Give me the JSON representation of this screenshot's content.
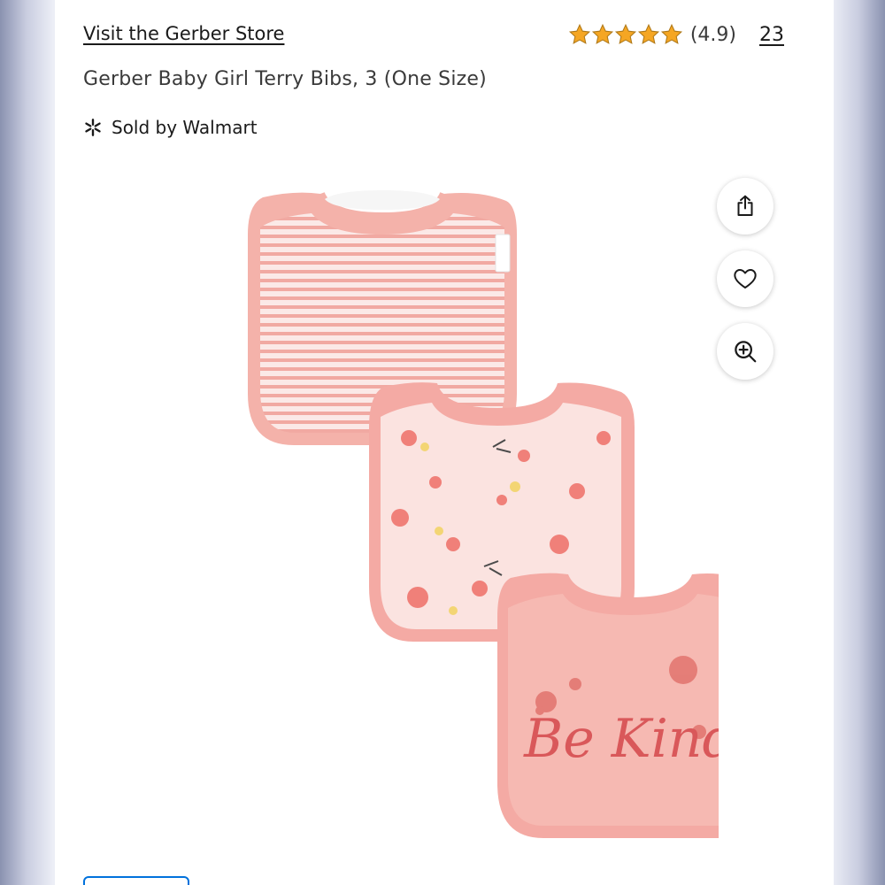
{
  "store": {
    "link_label": "Visit the Gerber Store"
  },
  "rating": {
    "stars": 5,
    "value": "(4.9)",
    "review_count": "23",
    "star_color": "#f5a623"
  },
  "product": {
    "title": "Gerber Baby Girl Terry Bibs, 3 (One Size)",
    "image_text": "Be Kind"
  },
  "seller": {
    "label": "Sold by Walmart",
    "icon": "walmart-spark-icon"
  },
  "actions": {
    "share_icon": "share-icon",
    "favorite_icon": "heart-icon",
    "zoom_icon": "zoom-in-icon"
  },
  "colors": {
    "bib_pink": "#f4aaa4",
    "bib_light": "#f9d6d2",
    "accent_blue": "#0071dc"
  }
}
